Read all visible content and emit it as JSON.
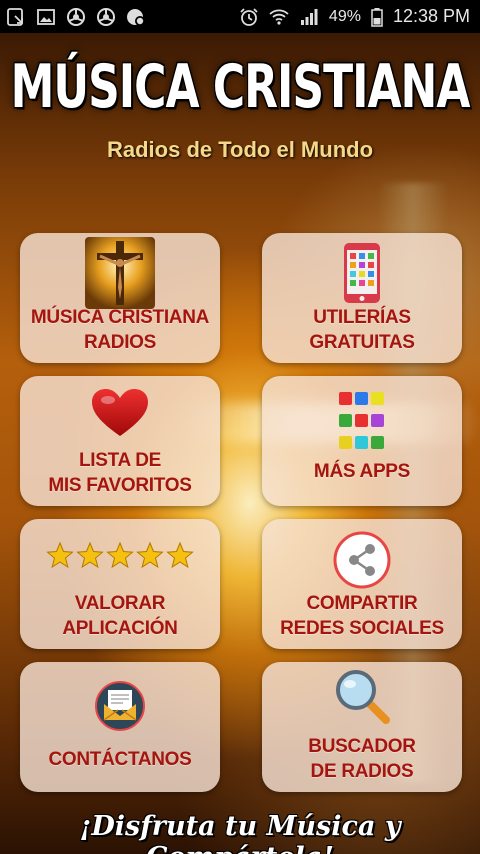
{
  "status_bar": {
    "battery": "49%",
    "time": "12:38 PM",
    "icons_left": [
      "download-notification-icon",
      "image-notification-icon",
      "chrome-icon",
      "chrome-icon",
      "chrome-incognito-icon"
    ],
    "icons_right": [
      "alarm-icon",
      "wifi-icon",
      "signal-icon",
      "battery-icon"
    ]
  },
  "header": {
    "title": "MÚSICA CRISTIANA",
    "subtitle": "Radios de Todo el Mundo"
  },
  "tiles": [
    {
      "label": "MÚSICA  CRISTIANA\nRADIOS",
      "icon": "crucifix-icon"
    },
    {
      "label": "UTILERÍAS\nGRATUITAS",
      "icon": "phone-apps-icon"
    },
    {
      "label": "LISTA DE\nMIS FAVORITOS",
      "icon": "heart-icon"
    },
    {
      "label": "MÁS APPS",
      "icon": "colored-squares-icon"
    },
    {
      "label": "VALORAR\nAPLICACIÓN",
      "icon": "five-stars-icon"
    },
    {
      "label": "COMPARTIR\nREDES SOCIALES",
      "icon": "share-icon"
    },
    {
      "label": "CONTÁCTANOS",
      "icon": "mail-icon"
    },
    {
      "label": "BUSCADOR\nDE RADIOS",
      "icon": "magnifier-icon"
    }
  ],
  "footer": {
    "text": "¡Disfruta tu Música y Compártela!"
  },
  "colors": {
    "tile_label": "#a5150f",
    "subtitle": "#f5d98a",
    "tile_bg": "#f5e1d2"
  }
}
